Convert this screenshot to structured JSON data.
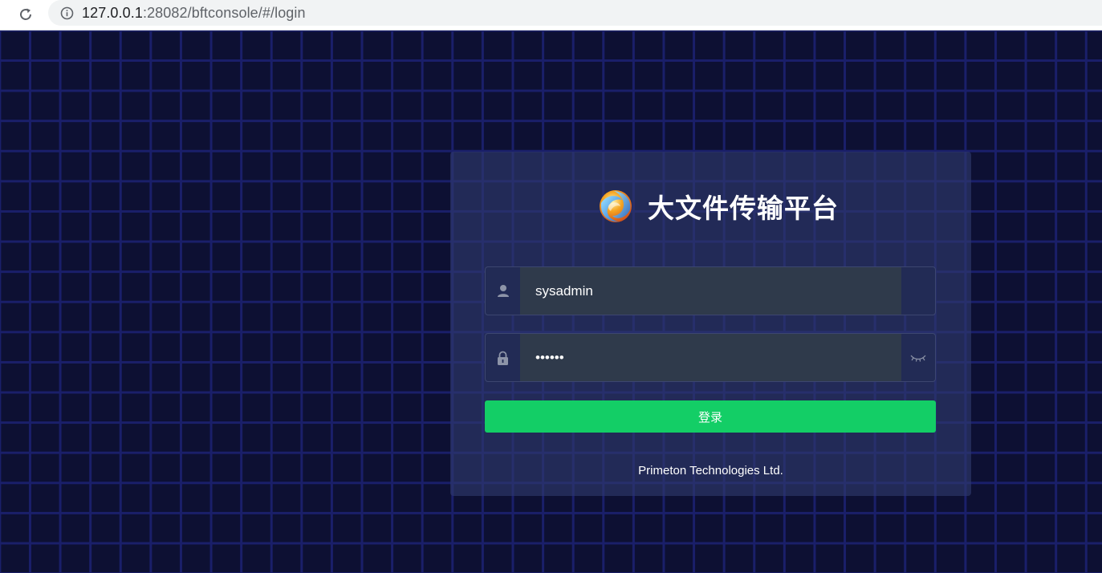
{
  "browser": {
    "url_host": "127.0.0.1",
    "url_rest": ":28082/bftconsole/#/login",
    "reload_icon": "reload-icon",
    "info_icon": "info-icon"
  },
  "login": {
    "title": "大文件传输平台",
    "logo_icon": "sphere-logo",
    "username": {
      "value": "sysadmin",
      "icon": "user-icon"
    },
    "password": {
      "masked_value": "••••••",
      "icon": "lock-icon",
      "toggle_icon": "eye-closed-icon"
    },
    "submit_label": "登录",
    "copyright": "Primeton Technologies Ltd."
  },
  "colors": {
    "background": "#0d1033",
    "grid_line": "#1a1f6a",
    "card": "#2c3567",
    "input_bg": "#2f3a4b",
    "button": "#13ce66"
  }
}
